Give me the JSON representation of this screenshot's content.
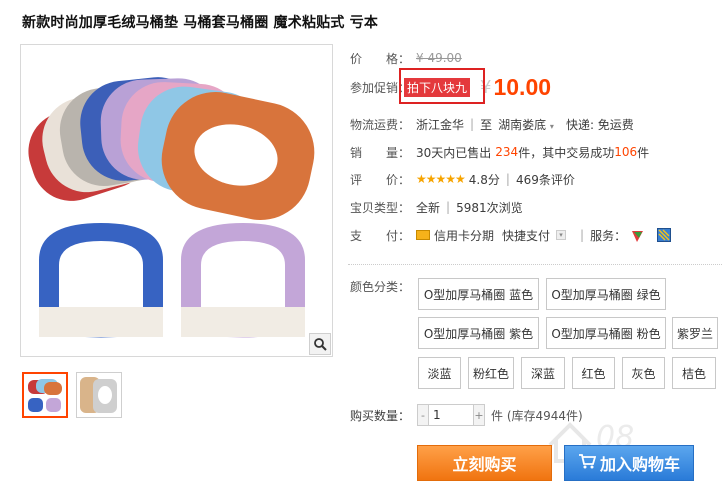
{
  "product": {
    "title": "新款时尚加厚毛绒马桶垫 马桶套马桶圈 魔术粘贴式 亏本"
  },
  "price": {
    "label": "价　　格：",
    "original": "¥ 49.00"
  },
  "promo": {
    "label": "参加促销：",
    "tag": "拍下八块九",
    "currency": "¥",
    "price": "10.00"
  },
  "shipping": {
    "label": "物流运费：",
    "from": "浙江金华",
    "to_prefix": "至",
    "to": "湖南娄底",
    "method": "快递: 免运费"
  },
  "sales": {
    "label": "销　　量：",
    "text_a": "30天内已售出",
    "sold": "234",
    "text_b": "件，其中交易成功",
    "success": "106",
    "text_c": "件"
  },
  "rating": {
    "label": "评　　价：",
    "stars": "★★★★★",
    "score": "4.8分",
    "reviews": "469条评价"
  },
  "item_type": {
    "label": "宝贝类型：",
    "condition": "全新",
    "views": "5981次浏览"
  },
  "payment": {
    "label": "支　　付：",
    "credit": "信用卡分期",
    "quick": "快捷支付",
    "service_label": "服务："
  },
  "sku": {
    "label": "颜色分类：",
    "options": [
      "O型加厚马桶圈 蓝色",
      "O型加厚马桶圈 绿色",
      "O型加厚马桶圈 紫色",
      "O型加厚马桶圈 粉色",
      "紫罗兰",
      "淡蓝",
      "粉红色",
      "深蓝",
      "红色",
      "灰色",
      "桔色"
    ]
  },
  "quantity": {
    "label": "购买数量：",
    "minus": "-",
    "value": "1",
    "plus": "+",
    "stock": "件 (库存4944件)"
  },
  "actions": {
    "buy": "立刻购买",
    "cart": "加入购物车"
  },
  "colors": {
    "accent": "#ff4400",
    "promo_bg": "#e4393c",
    "buy_btn": "#f07410",
    "cart_btn": "#2a7bd8"
  }
}
